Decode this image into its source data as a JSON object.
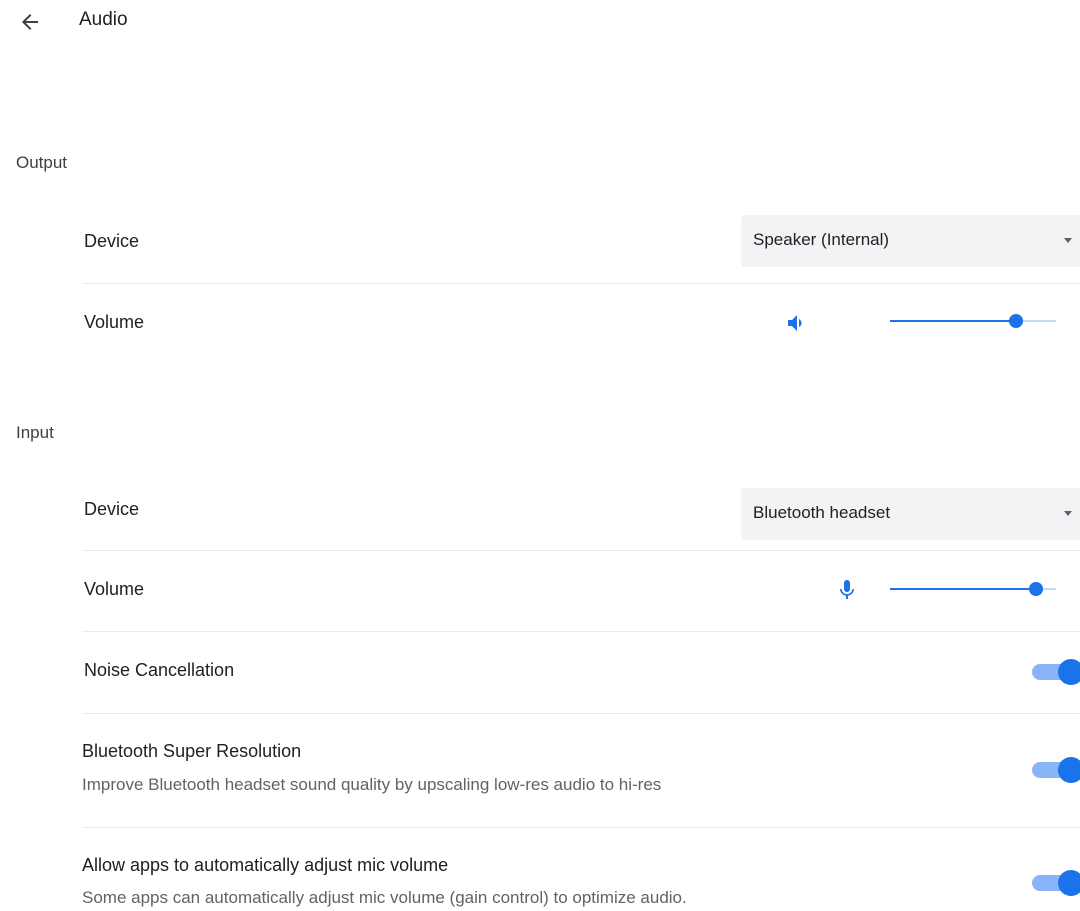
{
  "header": {
    "title": "Audio",
    "back_icon": "arrow-left-icon"
  },
  "output": {
    "section_title": "Output",
    "device_label": "Device",
    "device_value": "Speaker (Internal)",
    "volume_label": "Volume",
    "volume_icon": "speaker-volume-icon",
    "volume_level": 0.76
  },
  "input": {
    "section_title": "Input",
    "device_label": "Device",
    "device_value": "Bluetooth headset",
    "volume_label": "Volume",
    "volume_icon": "microphone-icon",
    "volume_level": 0.88
  },
  "toggles": [
    {
      "label": "Noise Cancellation",
      "description": "",
      "on": true
    },
    {
      "label": "Bluetooth Super Resolution",
      "description": "Improve Bluetooth headset sound quality by upscaling low-res audio to hi-res",
      "on": true
    },
    {
      "label": "Allow apps to automatically adjust mic volume",
      "description": "Some apps can automatically adjust mic volume (gain control) to optimize audio.",
      "on": true
    }
  ],
  "colors": {
    "accent": "#1a73e8",
    "accent_light": "#8ab4f8",
    "select_bg": "#f1f3f4"
  }
}
